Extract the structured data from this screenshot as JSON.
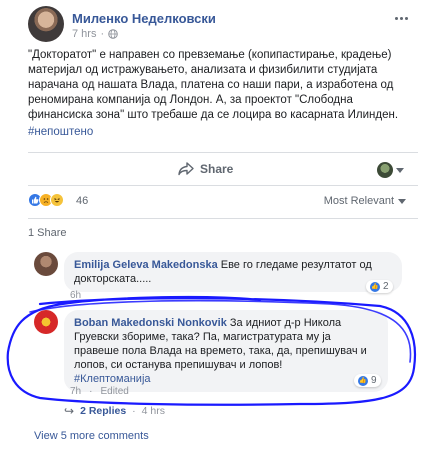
{
  "post": {
    "author": "Миленко Неделковски",
    "time": "7 hrs",
    "text": "\"Докторатот\" е направен со превземање (копипастирање, крадење) материјал од истражувањето, анализата и физибилити студијата нарачана од нашата Влада, платена со наши пари, а изработена од реномирана компанија од Лондон. А, за проектот \"Слободна финансиска зона\" што требаше да се лоцира во касарната Илинден.",
    "hashtag": "#непоштено"
  },
  "actions": {
    "share_label": "Share"
  },
  "reactions": {
    "count": "46",
    "sort_label": "Most Relevant"
  },
  "share_count": "1 Share",
  "comments": [
    {
      "name": "Emilija Geleva Makedonska",
      "text": "Еве го гледаме резултатот од докторската.....",
      "time": "6h",
      "likes": "2"
    },
    {
      "name": "Boban Makedonski Nonkovik",
      "text": "За идниот д-р Никола Груевски збориме, така? Па, магистратурата му ја правеше пола Влада на времето, така, да, препишувач и лопов, си останува препишувач и лопов!",
      "hashtag": "#Клептоманија",
      "time": "7h",
      "edited": "Edited",
      "likes": "9"
    }
  ],
  "replies": {
    "label": "2 Replies",
    "time": "4 hrs"
  },
  "view_more": "View 5 more comments",
  "colors": {
    "link": "#385898",
    "annotation": "#1a1aff",
    "like": "#3578e5"
  }
}
